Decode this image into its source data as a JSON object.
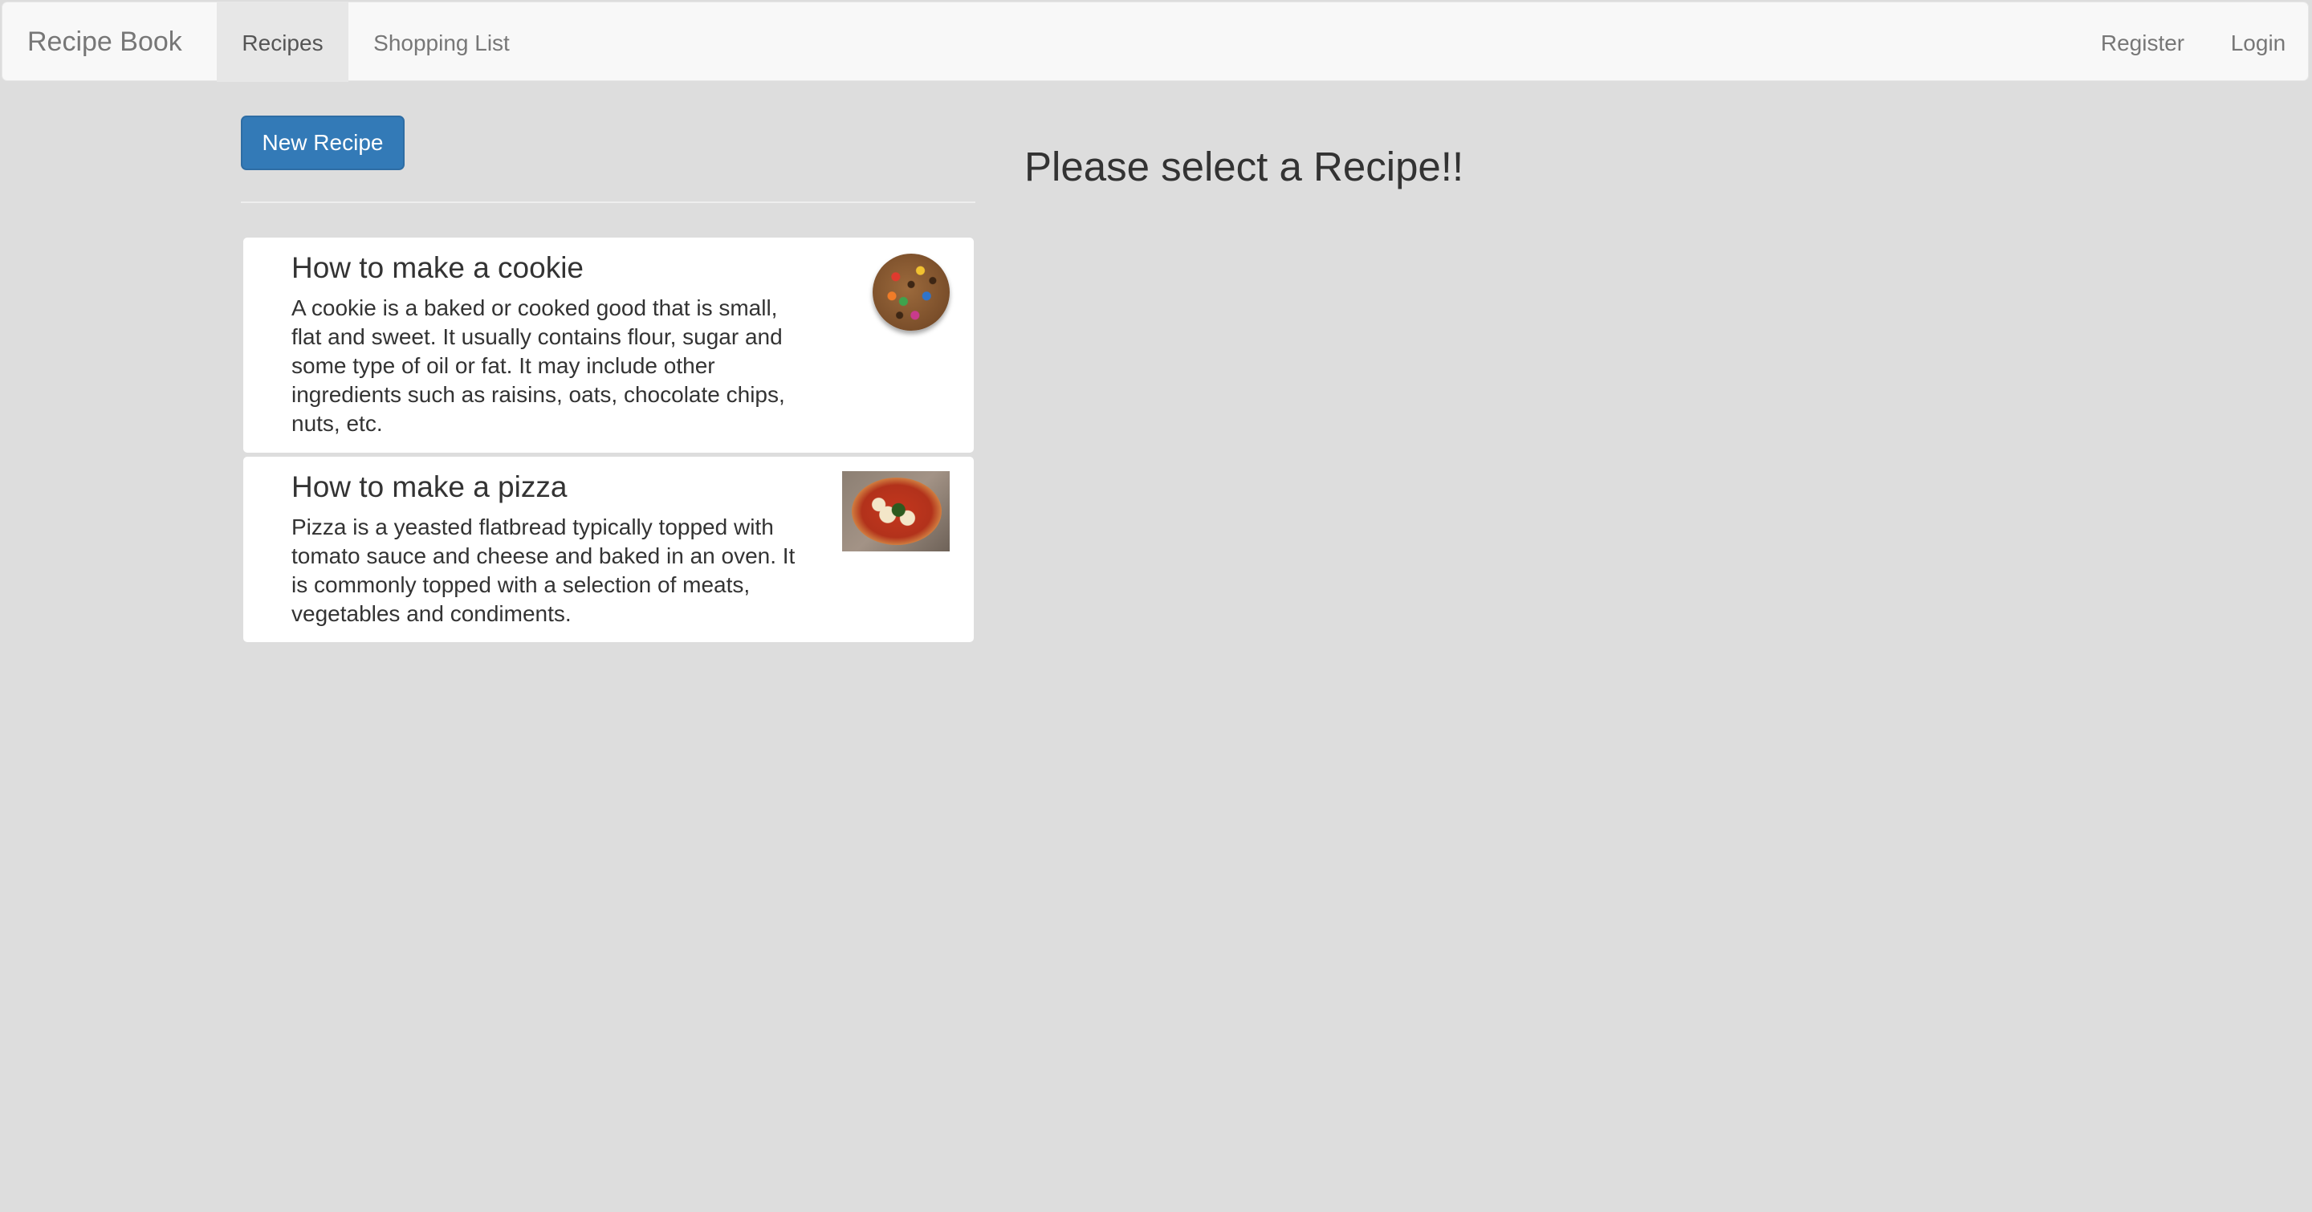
{
  "navbar": {
    "brand": "Recipe Book",
    "left_items": [
      {
        "label": "Recipes",
        "active": true
      },
      {
        "label": "Shopping List",
        "active": false
      }
    ],
    "right_items": [
      {
        "label": "Register"
      },
      {
        "label": "Login"
      }
    ]
  },
  "actions": {
    "new_recipe_label": "New Recipe"
  },
  "recipes": [
    {
      "name": "How to make a cookie",
      "description": "A cookie is a baked or cooked good that is small, flat and sweet. It usually contains flour, sugar and some type of oil or fat. It may include other ingredients such as raisins, oats, chocolate chips, nuts, etc.",
      "image_icon": "cookie-image"
    },
    {
      "name": "How to make a pizza",
      "description": "Pizza is a yeasted flatbread typically topped with tomato sauce and cheese and baked in an oven. It is commonly topped with a selection of meats, vegetables and condiments.",
      "image_icon": "pizza-image"
    }
  ],
  "detail": {
    "placeholder": "Please select a Recipe!!"
  },
  "colors": {
    "background": "#dddddd",
    "navbar_bg": "#f8f8f8",
    "navbar_active": "#e7e7e7",
    "primary_button": "#337ab7"
  }
}
